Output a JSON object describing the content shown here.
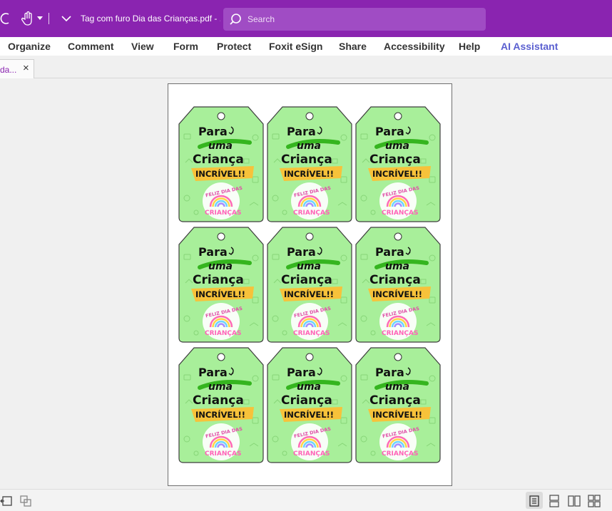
{
  "titlebar": {
    "document_title": "Tag com furo Dia das Crianças.pdf - ...",
    "search_placeholder": "Search"
  },
  "menu": [
    "Organize",
    "Comment",
    "View",
    "Form",
    "Protect",
    "Foxit eSign",
    "Share",
    "Accessibility",
    "Help",
    "AI Assistant"
  ],
  "tab": {
    "label": "da...",
    "close": "×"
  },
  "tag_text": {
    "line1": "Para",
    "line2": "uma",
    "line3": "Criança",
    "line4": "INCRÍVEL!!",
    "badge_top": "FELIZ DIA DAS",
    "badge_bottom": "CRIANÇAS"
  },
  "colors": {
    "brand_purple": "#8a24b0",
    "ai_blue": "#5a5fd0",
    "tag_green": "#a8ef9a",
    "banner_yellow": "#f7c23a",
    "badge_pink": "#ff63b8"
  },
  "status_icons": [
    "fit-page-icon",
    "page-layout-icon",
    "single-page-icon",
    "continuous-icon",
    "two-page-icon",
    "two-page-continuous-icon"
  ]
}
